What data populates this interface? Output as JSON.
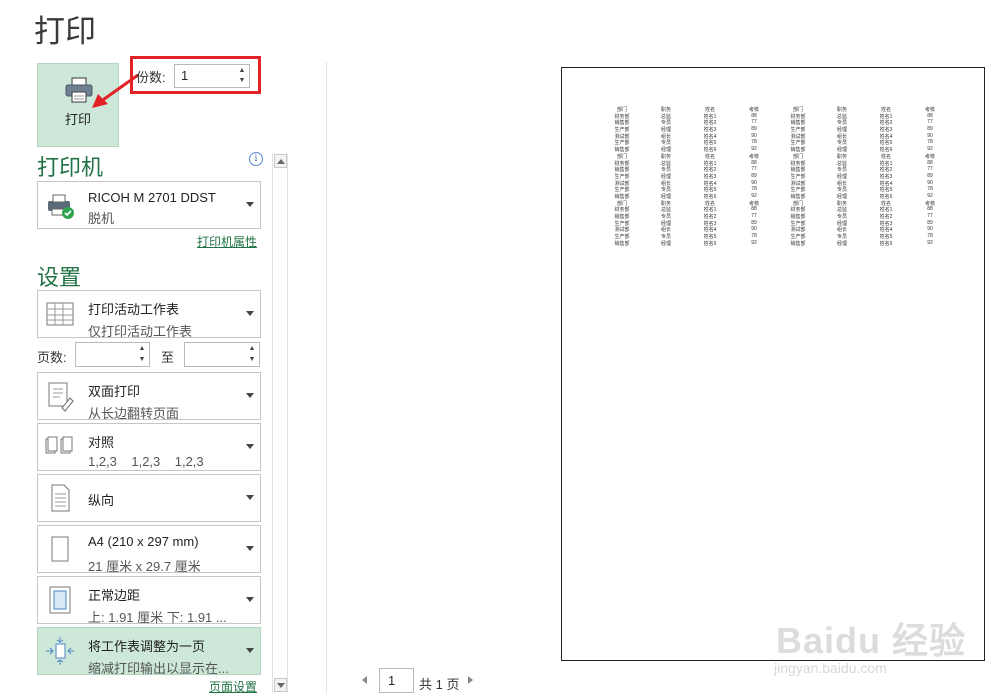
{
  "title": "打印",
  "print_button_label": "打印",
  "copies": {
    "label": "份数:",
    "value": "1"
  },
  "printer_heading": "打印机",
  "printer": {
    "name": "RICOH M 2701 DDST",
    "status": "脱机",
    "properties_link": "打印机属性"
  },
  "settings_heading": "设置",
  "settings": {
    "print_what": {
      "title": "打印活动工作表",
      "subtitle": "仅打印活动工作表"
    },
    "pages": {
      "label": "页数:",
      "to_label": "至"
    },
    "duplex": {
      "title": "双面打印",
      "subtitle": "从长边翻转页面"
    },
    "collate": {
      "title": "对照",
      "subtitle": "1,2,3    1,2,3    1,2,3"
    },
    "orientation": {
      "title": "纵向"
    },
    "paper": {
      "title": "A4 (210 x 297 mm)",
      "subtitle": "21 厘米 x 29.7 厘米"
    },
    "margins": {
      "title": "正常边距",
      "subtitle": "上: 1.91 厘米 下: 1.91 ..."
    },
    "scaling": {
      "title": "将工作表调整为一页",
      "subtitle": "缩减打印输出以显示在..."
    },
    "page_setup_link": "页面设置"
  },
  "preview": {
    "headers": [
      "部门",
      "职务",
      "姓名",
      "考核",
      "部门",
      "职务",
      "姓名",
      "考核"
    ],
    "rows": [
      [
        "财务部",
        "总监",
        "姓名1",
        "88",
        "财务部",
        "总监",
        "姓名1",
        "88"
      ],
      [
        "销售部",
        "专员",
        "姓名2",
        "77",
        "销售部",
        "专员",
        "姓名2",
        "77"
      ],
      [
        "生产部",
        "经理",
        "姓名3",
        "89",
        "生产部",
        "经理",
        "姓名3",
        "89"
      ],
      [
        "测试部",
        "组长",
        "姓名4",
        "90",
        "测试部",
        "组长",
        "姓名4",
        "90"
      ],
      [
        "生产部",
        "专员",
        "姓名5",
        "78",
        "生产部",
        "专员",
        "姓名5",
        "78"
      ],
      [
        "销售部",
        "经理",
        "姓名6",
        "92",
        "销售部",
        "经理",
        "姓名6",
        "92"
      ]
    ],
    "blocks": 3
  },
  "pager": {
    "current": "1",
    "total": "共 1 页"
  },
  "watermark": {
    "main": "Baidu 经验",
    "sub": "jingyan.baidu.com"
  },
  "colors": {
    "accent": "#217346",
    "highlight": "#cde8d8",
    "callout": "#e32227"
  }
}
